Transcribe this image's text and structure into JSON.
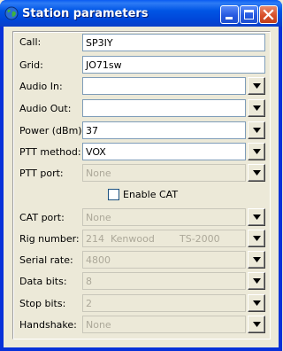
{
  "window": {
    "title": "Station parameters",
    "icon": "globe-icon",
    "buttons": {
      "minimize": "minimize-icon",
      "maximize": "maximize-icon",
      "close": "close-icon"
    }
  },
  "form": {
    "call": {
      "label": "Call:",
      "value": "SP3IY"
    },
    "grid": {
      "label": "Grid:",
      "value": "JO71sw"
    },
    "audio_in": {
      "label": "Audio In:",
      "value": ""
    },
    "audio_out": {
      "label": "Audio Out:",
      "value": ""
    },
    "power": {
      "label": "Power (dBm):",
      "value": "37"
    },
    "ptt_method": {
      "label": "PTT method:",
      "value": "VOX"
    },
    "ptt_port": {
      "label": "PTT port:",
      "value": "None"
    },
    "enable_cat": {
      "label": "Enable CAT",
      "checked": false
    },
    "cat_port": {
      "label": "CAT port:",
      "value": "None"
    },
    "rig_number": {
      "label": "Rig number:",
      "number": "214",
      "maker": "Kenwood",
      "model": "TS-2000"
    },
    "serial_rate": {
      "label": "Serial rate:",
      "value": "4800"
    },
    "data_bits": {
      "label": "Data bits:",
      "value": "8"
    },
    "stop_bits": {
      "label": "Stop bits:",
      "value": "2"
    },
    "handshake": {
      "label": "Handshake:",
      "value": "None"
    }
  },
  "colors": {
    "title_bar": "#0055e5",
    "window_bg": "#ece9d8",
    "disabled_text": "#aca899",
    "close_button": "#d8502a"
  }
}
